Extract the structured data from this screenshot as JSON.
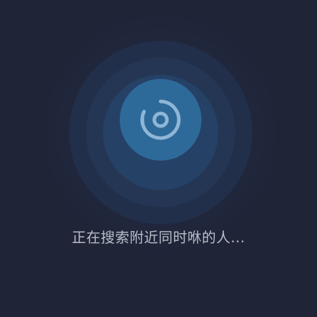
{
  "status": {
    "text": "正在搜索附近同时咻的人..."
  },
  "icons": {
    "center": "radar-scan-icon"
  },
  "colors": {
    "background": "#1f2436",
    "core": "#2e6a99",
    "icon": "#8fb6d6",
    "text": "#b9bdc8"
  }
}
